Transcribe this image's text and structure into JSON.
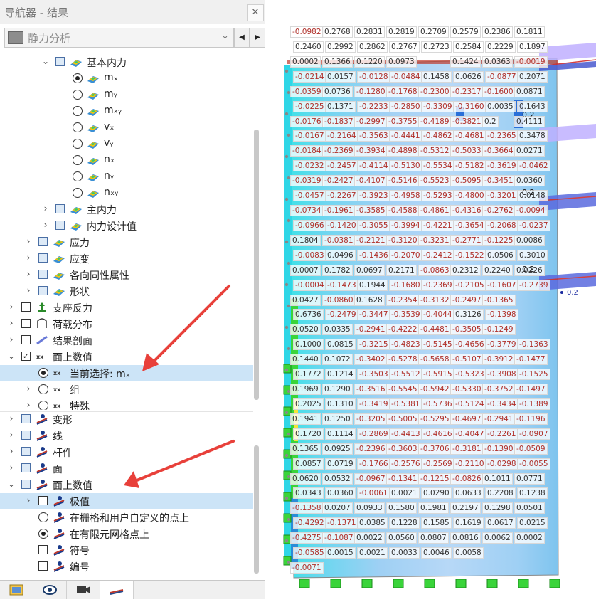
{
  "window": {
    "title": "导航器 - 结果",
    "close_glyph": "✕"
  },
  "combo": {
    "value": "静力分析"
  },
  "tree_upper": [
    {
      "label": "基本内力",
      "indent": 1,
      "exp": "down",
      "kind": "checkbox",
      "checked": false
    },
    {
      "label": "mₓ",
      "indent": 2,
      "kind": "radio",
      "on": true
    },
    {
      "label": "mᵧ",
      "indent": 2,
      "kind": "radio",
      "on": false
    },
    {
      "label": "mₓᵧ",
      "indent": 2,
      "kind": "radio",
      "on": false
    },
    {
      "label": "vₓ",
      "indent": 2,
      "kind": "radio",
      "on": false
    },
    {
      "label": "vᵧ",
      "indent": 2,
      "kind": "radio",
      "on": false
    },
    {
      "label": "nₓ",
      "indent": 2,
      "kind": "radio",
      "on": false
    },
    {
      "label": "nᵧ",
      "indent": 2,
      "kind": "radio",
      "on": false
    },
    {
      "label": "nₓᵧ",
      "indent": 2,
      "kind": "radio",
      "on": false
    },
    {
      "label": "主内力",
      "indent": 1,
      "exp": "right",
      "kind": "checkbox"
    },
    {
      "label": "内力设计值",
      "indent": 1,
      "exp": "right",
      "kind": "checkbox"
    },
    {
      "label": "应力",
      "indent": 0,
      "exp": "right",
      "kind": "checkbox"
    },
    {
      "label": "应变",
      "indent": 0,
      "exp": "right",
      "kind": "checkbox"
    },
    {
      "label": "各向同性属性",
      "indent": 0,
      "exp": "right",
      "kind": "checkbox"
    },
    {
      "label": "形状",
      "indent": 0,
      "exp": "right",
      "kind": "checkbox"
    },
    {
      "label": "支座反力",
      "indent": -1,
      "exp": "right",
      "kind": "checkbox-plain"
    },
    {
      "label": "荷载分布",
      "indent": -1,
      "exp": "right",
      "kind": "checkbox-plain"
    },
    {
      "label": "结果剖面",
      "indent": -1,
      "exp": "right",
      "kind": "checkbox-plain"
    },
    {
      "label": "面上数值",
      "indent": -1,
      "exp": "down",
      "kind": "checkbox-plain",
      "checked": true
    },
    {
      "label": "当前选择: mₓ",
      "indent": 0,
      "kind": "radio",
      "on": true,
      "selected": true
    },
    {
      "label": "组",
      "indent": 0,
      "exp": "right",
      "kind": "radio",
      "on": false
    },
    {
      "label": "特殊",
      "indent": 0,
      "exp": "right",
      "kind": "radio",
      "on": false
    }
  ],
  "tree_lower": [
    {
      "label": "变形",
      "exp": "right",
      "kind": "checkbox",
      "indent": -1
    },
    {
      "label": "线",
      "exp": "right",
      "kind": "checkbox",
      "indent": -1
    },
    {
      "label": "杆件",
      "exp": "right",
      "kind": "checkbox",
      "indent": -1
    },
    {
      "label": "面",
      "exp": "right",
      "kind": "checkbox",
      "indent": -1
    },
    {
      "label": "面上数值",
      "exp": "down",
      "kind": "checkbox",
      "indent": -1
    },
    {
      "label": "极值",
      "exp": "right",
      "kind": "checkbox-plain",
      "indent": 0,
      "selected": true
    },
    {
      "label": "在栅格和用户自定义的点上",
      "kind": "radio",
      "on": false,
      "indent": 0
    },
    {
      "label": "在有限元网格点上",
      "kind": "radio",
      "on": true,
      "indent": 0
    },
    {
      "label": "符号",
      "kind": "checkbox-plain",
      "indent": 0
    },
    {
      "label": "编号",
      "kind": "checkbox-plain",
      "indent": 0
    }
  ],
  "bottom_tabs": [
    "data-icon",
    "eye-icon",
    "camera-icon",
    "results-icon"
  ],
  "colors": {
    "accent_red": "#e8403a",
    "selected_row": "#cce4f7",
    "contour_blue": "#2a8cd8",
    "contour_cyan": "#39e2e6",
    "contour_green": "#3ad43a"
  },
  "value_grid": [
    [
      "-0.0982",
      "0.2768",
      "0.2831",
      "0.2819",
      "0.2709",
      "0.2579",
      "0.2386",
      "0.1811"
    ],
    [
      "0.2460",
      "0.2992",
      "0.2862",
      "0.2767",
      "0.2723",
      "0.2584",
      "0.2229",
      "0.1897"
    ],
    [
      "0.0002",
      "0.1366",
      "0.1220",
      "0.0973",
      "",
      "0.1424",
      "0.0363",
      "-0.0019"
    ],
    [
      "-0.0214",
      "0.0157",
      "-0.0128",
      "-0.0484",
      "0.1458",
      "0.0626",
      "-0.0877",
      "0.2071"
    ],
    [
      "-0.0359",
      "0.0736",
      "-0.1280",
      "-0.1768",
      "-0.2300",
      "-0.2317",
      "-0.1600",
      "0.0871"
    ],
    [
      "-0.0225",
      "0.1371",
      "-0.2233",
      "-0.2850",
      "-0.3309",
      "-0.3160",
      "0.0035",
      "0.1643"
    ],
    [
      "-0.0176",
      "-0.1837",
      "-0.2997",
      "-0.3755",
      "-0.4189",
      "-0.3821",
      "0.2",
      "0.4111"
    ],
    [
      "-0.0167",
      "-0.2164",
      "-0.3563",
      "-0.4441",
      "-0.4862",
      "-0.4681",
      "-0.2365",
      "0.3478"
    ],
    [
      "-0.0184",
      "-0.2369",
      "-0.3934",
      "-0.4898",
      "-0.5312",
      "-0.5033",
      "-0.3664",
      "0.0271"
    ],
    [
      "-0.0232",
      "-0.2457",
      "-0.4114",
      "-0.5130",
      "-0.5534",
      "-0.5182",
      "-0.3619",
      "-0.0462"
    ],
    [
      "-0.0319",
      "-0.2427",
      "-0.4107",
      "-0.5146",
      "-0.5523",
      "-0.5095",
      "-0.3451",
      "0.0360"
    ],
    [
      "-0.0457",
      "-0.2267",
      "-0.3923",
      "-0.4958",
      "-0.5293",
      "-0.4800",
      "-0.3201",
      "0.0148"
    ],
    [
      "-0.0734",
      "-0.1961",
      "-0.3585",
      "-0.4588",
      "-0.4861",
      "-0.4316",
      "-0.2762",
      "-0.0094"
    ],
    [
      "-0.0966",
      "-0.1420",
      "-0.3055",
      "-0.3994",
      "-0.4221",
      "-0.3654",
      "-0.2068",
      "-0.0237"
    ],
    [
      "0.1804",
      "-0.0381",
      "-0.2121",
      "-0.3120",
      "-0.3231",
      "-0.2771",
      "-0.1225",
      "0.0086"
    ],
    [
      "-0.0083",
      "0.0496",
      "-0.1436",
      "-0.2070",
      "-0.2412",
      "-0.1522",
      "0.0506",
      "0.3010"
    ],
    [
      "0.0007",
      "0.1782",
      "0.0697",
      "0.2171",
      "-0.0863",
      "0.2312",
      "0.2240",
      "0.0226"
    ],
    [
      "-0.0004",
      "-0.1473",
      "0.1944",
      "-0.1680",
      "-0.2369",
      "-0.2105",
      "-0.1607",
      "-0.2739"
    ],
    [
      "0.0427",
      "-0.0860",
      "0.1628",
      "-0.2354",
      "-0.3132",
      "-0.2497",
      "-0.1365",
      ""
    ],
    [
      "0.6736",
      "-0.2479",
      "-0.3447",
      "-0.3539",
      "-0.4044",
      "0.3126",
      "-0.1398",
      ""
    ],
    [
      "0.0520",
      "0.0335",
      "-0.2941",
      "-0.4222",
      "-0.4481",
      "-0.3505",
      "-0.1249",
      ""
    ],
    [
      "0.1000",
      "0.0815",
      "-0.3215",
      "-0.4823",
      "-0.5145",
      "-0.4656",
      "-0.3779",
      "-0.1363"
    ],
    [
      "0.1440",
      "0.1072",
      "-0.3402",
      "-0.5278",
      "-0.5658",
      "-0.5107",
      "-0.3912",
      "-0.1477"
    ],
    [
      "0.1772",
      "0.1214",
      "-0.3503",
      "-0.5512",
      "-0.5915",
      "-0.5323",
      "-0.3908",
      "-0.1525"
    ],
    [
      "0.1969",
      "0.1290",
      "-0.3516",
      "-0.5545",
      "-0.5942",
      "-0.5330",
      "-0.3752",
      "-0.1497"
    ],
    [
      "0.2025",
      "0.1310",
      "-0.3419",
      "-0.5381",
      "-0.5736",
      "-0.5124",
      "-0.3434",
      "-0.1389"
    ],
    [
      "0.1941",
      "0.1250",
      "-0.3205",
      "-0.5005",
      "-0.5295",
      "-0.4697",
      "-0.2941",
      "-0.1196"
    ],
    [
      "0.1720",
      "0.1114",
      "-0.2869",
      "-0.4413",
      "-0.4616",
      "-0.4047",
      "-0.2261",
      "-0.0907"
    ],
    [
      "0.1365",
      "0.0925",
      "-0.2396",
      "-0.3603",
      "-0.3706",
      "-0.3181",
      "-0.1390",
      "-0.0509"
    ],
    [
      "0.0857",
      "0.0719",
      "-0.1766",
      "-0.2576",
      "-0.2569",
      "-0.2110",
      "-0.0298",
      "-0.0055"
    ],
    [
      "0.0620",
      "0.0532",
      "-0.0967",
      "-0.1341",
      "-0.1215",
      "-0.0826",
      "0.1011",
      "0.0771"
    ],
    [
      "0.0343",
      "0.0360",
      "-0.0061",
      "0.0021",
      "0.0290",
      "0.0633",
      "0.2208",
      "0.1238"
    ],
    [
      "-0.1358",
      "0.0207",
      "0.0933",
      "0.1580",
      "0.1981",
      "0.2197",
      "0.1298",
      "0.0501"
    ],
    [
      "-0.4292",
      "-0.1371",
      "0.0385",
      "0.1228",
      "0.1585",
      "0.1619",
      "0.0617",
      "0.0215"
    ],
    [
      "-0.4275",
      "-0.1087",
      "0.0022",
      "0.0560",
      "0.0807",
      "0.0816",
      "0.0062",
      "0.0002"
    ],
    [
      "-0.0585",
      "0.0015",
      "0.0021",
      "0.0033",
      "0.0046",
      "0.0058",
      "",
      ""
    ],
    [
      "-0.0071",
      "",
      "",
      "",
      "",
      "",
      "",
      ""
    ]
  ],
  "marker_labels": [
    "0.2",
    "0.2",
    "0.2",
    "0.2"
  ]
}
